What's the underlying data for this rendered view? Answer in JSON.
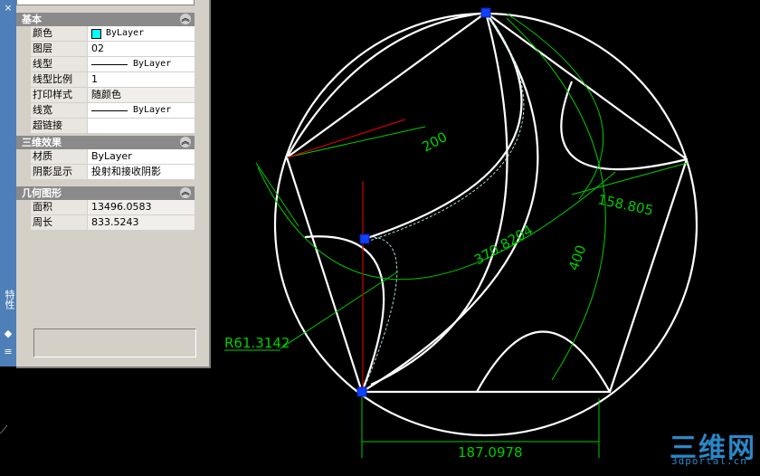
{
  "palette": {
    "title": "特性",
    "sections": [
      {
        "title": "基本",
        "rows": [
          {
            "key": "颜色",
            "value": "ByLayer",
            "swatch": "#00ffff"
          },
          {
            "key": "图层",
            "value": "02"
          },
          {
            "key": "线型",
            "value": "ByLayer",
            "lineicon": true
          },
          {
            "key": "线型比例",
            "value": "1"
          },
          {
            "key": "打印样式",
            "value": "随颜色"
          },
          {
            "key": "线宽",
            "value": "ByLayer",
            "lineicon": true
          },
          {
            "key": "超链接",
            "value": ""
          }
        ]
      },
      {
        "title": "三维效果",
        "rows": [
          {
            "key": "材质",
            "value": "ByLayer"
          },
          {
            "key": "阴影显示",
            "value": "投射和接收阴影"
          }
        ]
      },
      {
        "title": "几何图形",
        "rows": [
          {
            "key": "面积",
            "value": "13496.0583"
          },
          {
            "key": "周长",
            "value": "833.5243"
          }
        ]
      }
    ]
  },
  "drawing": {
    "dimensions": {
      "d200": "200",
      "d370": "370.8204",
      "d158": "158.805",
      "d400": "400",
      "radius": "R61.3142",
      "width": "187.0978"
    },
    "colors": {
      "geometry": "#ffffff",
      "dimension": "#00cc00",
      "selection": "#cc0000",
      "grip": "#1040ff"
    }
  },
  "watermark": {
    "main": "三维网",
    "sub": "3dportal.cn"
  }
}
